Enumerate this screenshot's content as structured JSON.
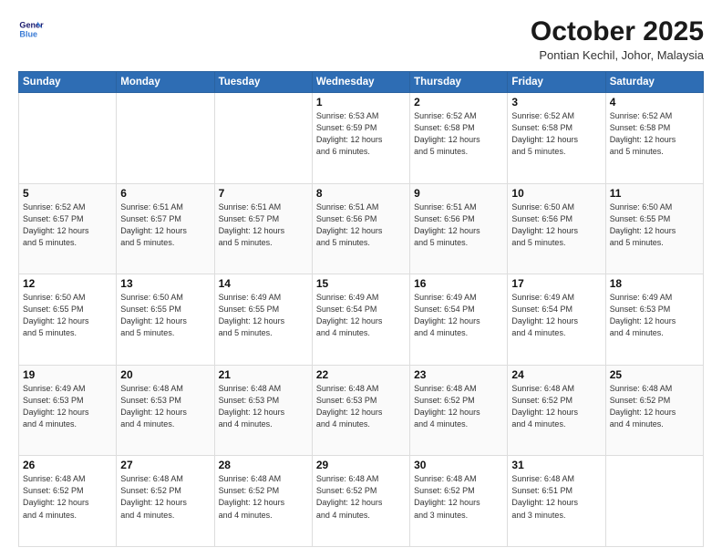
{
  "logo": {
    "line1": "General",
    "line2": "Blue"
  },
  "header": {
    "month": "October 2025",
    "location": "Pontian Kechil, Johor, Malaysia"
  },
  "weekdays": [
    "Sunday",
    "Monday",
    "Tuesday",
    "Wednesday",
    "Thursday",
    "Friday",
    "Saturday"
  ],
  "weeks": [
    [
      {
        "day": "",
        "info": ""
      },
      {
        "day": "",
        "info": ""
      },
      {
        "day": "",
        "info": ""
      },
      {
        "day": "1",
        "info": "Sunrise: 6:53 AM\nSunset: 6:59 PM\nDaylight: 12 hours\nand 6 minutes."
      },
      {
        "day": "2",
        "info": "Sunrise: 6:52 AM\nSunset: 6:58 PM\nDaylight: 12 hours\nand 5 minutes."
      },
      {
        "day": "3",
        "info": "Sunrise: 6:52 AM\nSunset: 6:58 PM\nDaylight: 12 hours\nand 5 minutes."
      },
      {
        "day": "4",
        "info": "Sunrise: 6:52 AM\nSunset: 6:58 PM\nDaylight: 12 hours\nand 5 minutes."
      }
    ],
    [
      {
        "day": "5",
        "info": "Sunrise: 6:52 AM\nSunset: 6:57 PM\nDaylight: 12 hours\nand 5 minutes."
      },
      {
        "day": "6",
        "info": "Sunrise: 6:51 AM\nSunset: 6:57 PM\nDaylight: 12 hours\nand 5 minutes."
      },
      {
        "day": "7",
        "info": "Sunrise: 6:51 AM\nSunset: 6:57 PM\nDaylight: 12 hours\nand 5 minutes."
      },
      {
        "day": "8",
        "info": "Sunrise: 6:51 AM\nSunset: 6:56 PM\nDaylight: 12 hours\nand 5 minutes."
      },
      {
        "day": "9",
        "info": "Sunrise: 6:51 AM\nSunset: 6:56 PM\nDaylight: 12 hours\nand 5 minutes."
      },
      {
        "day": "10",
        "info": "Sunrise: 6:50 AM\nSunset: 6:56 PM\nDaylight: 12 hours\nand 5 minutes."
      },
      {
        "day": "11",
        "info": "Sunrise: 6:50 AM\nSunset: 6:55 PM\nDaylight: 12 hours\nand 5 minutes."
      }
    ],
    [
      {
        "day": "12",
        "info": "Sunrise: 6:50 AM\nSunset: 6:55 PM\nDaylight: 12 hours\nand 5 minutes."
      },
      {
        "day": "13",
        "info": "Sunrise: 6:50 AM\nSunset: 6:55 PM\nDaylight: 12 hours\nand 5 minutes."
      },
      {
        "day": "14",
        "info": "Sunrise: 6:49 AM\nSunset: 6:55 PM\nDaylight: 12 hours\nand 5 minutes."
      },
      {
        "day": "15",
        "info": "Sunrise: 6:49 AM\nSunset: 6:54 PM\nDaylight: 12 hours\nand 4 minutes."
      },
      {
        "day": "16",
        "info": "Sunrise: 6:49 AM\nSunset: 6:54 PM\nDaylight: 12 hours\nand 4 minutes."
      },
      {
        "day": "17",
        "info": "Sunrise: 6:49 AM\nSunset: 6:54 PM\nDaylight: 12 hours\nand 4 minutes."
      },
      {
        "day": "18",
        "info": "Sunrise: 6:49 AM\nSunset: 6:53 PM\nDaylight: 12 hours\nand 4 minutes."
      }
    ],
    [
      {
        "day": "19",
        "info": "Sunrise: 6:49 AM\nSunset: 6:53 PM\nDaylight: 12 hours\nand 4 minutes."
      },
      {
        "day": "20",
        "info": "Sunrise: 6:48 AM\nSunset: 6:53 PM\nDaylight: 12 hours\nand 4 minutes."
      },
      {
        "day": "21",
        "info": "Sunrise: 6:48 AM\nSunset: 6:53 PM\nDaylight: 12 hours\nand 4 minutes."
      },
      {
        "day": "22",
        "info": "Sunrise: 6:48 AM\nSunset: 6:53 PM\nDaylight: 12 hours\nand 4 minutes."
      },
      {
        "day": "23",
        "info": "Sunrise: 6:48 AM\nSunset: 6:52 PM\nDaylight: 12 hours\nand 4 minutes."
      },
      {
        "day": "24",
        "info": "Sunrise: 6:48 AM\nSunset: 6:52 PM\nDaylight: 12 hours\nand 4 minutes."
      },
      {
        "day": "25",
        "info": "Sunrise: 6:48 AM\nSunset: 6:52 PM\nDaylight: 12 hours\nand 4 minutes."
      }
    ],
    [
      {
        "day": "26",
        "info": "Sunrise: 6:48 AM\nSunset: 6:52 PM\nDaylight: 12 hours\nand 4 minutes."
      },
      {
        "day": "27",
        "info": "Sunrise: 6:48 AM\nSunset: 6:52 PM\nDaylight: 12 hours\nand 4 minutes."
      },
      {
        "day": "28",
        "info": "Sunrise: 6:48 AM\nSunset: 6:52 PM\nDaylight: 12 hours\nand 4 minutes."
      },
      {
        "day": "29",
        "info": "Sunrise: 6:48 AM\nSunset: 6:52 PM\nDaylight: 12 hours\nand 4 minutes."
      },
      {
        "day": "30",
        "info": "Sunrise: 6:48 AM\nSunset: 6:52 PM\nDaylight: 12 hours\nand 3 minutes."
      },
      {
        "day": "31",
        "info": "Sunrise: 6:48 AM\nSunset: 6:51 PM\nDaylight: 12 hours\nand 3 minutes."
      },
      {
        "day": "",
        "info": ""
      }
    ]
  ]
}
